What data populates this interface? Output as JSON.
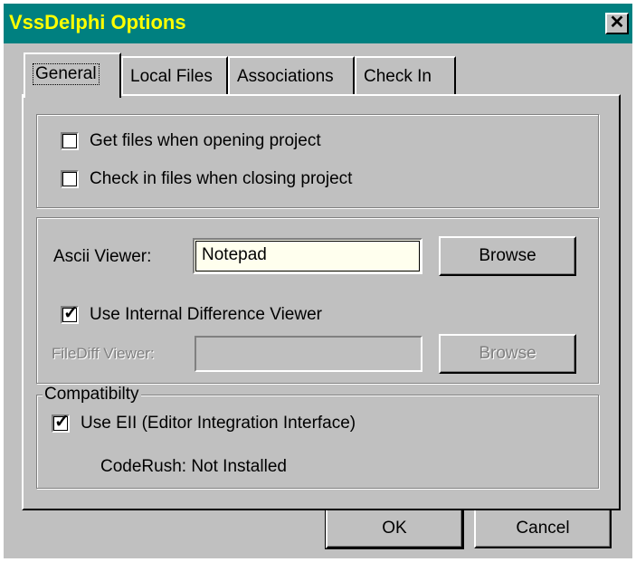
{
  "window": {
    "title": "VssDelphi Options",
    "close_symbol": "✕"
  },
  "tabs": [
    {
      "label": "General",
      "active": true
    },
    {
      "label": "Local Files",
      "active": false
    },
    {
      "label": "Associations",
      "active": false
    },
    {
      "label": "Check In",
      "active": false
    }
  ],
  "project_group": {
    "get_files": {
      "label": "Get files when opening project",
      "checked": false
    },
    "check_in": {
      "label": "Check in files when closing project",
      "checked": false
    }
  },
  "viewer_group": {
    "ascii_label": "Ascii Viewer:",
    "ascii_value": "Notepad",
    "browse1": "Browse",
    "use_internal": {
      "label": "Use Internal Difference Viewer",
      "checked": true
    },
    "filediff_label": "FileDiff Viewer:",
    "filediff_value": "",
    "browse2": "Browse"
  },
  "compat_group": {
    "title": "Compatibilty",
    "use_eii": {
      "label": "Use EII (Editor Integration Interface)",
      "checked": true
    },
    "coderush": "CodeRush: Not Installed"
  },
  "buttons": {
    "ok": "OK",
    "cancel": "Cancel"
  },
  "check_mark": "✓"
}
